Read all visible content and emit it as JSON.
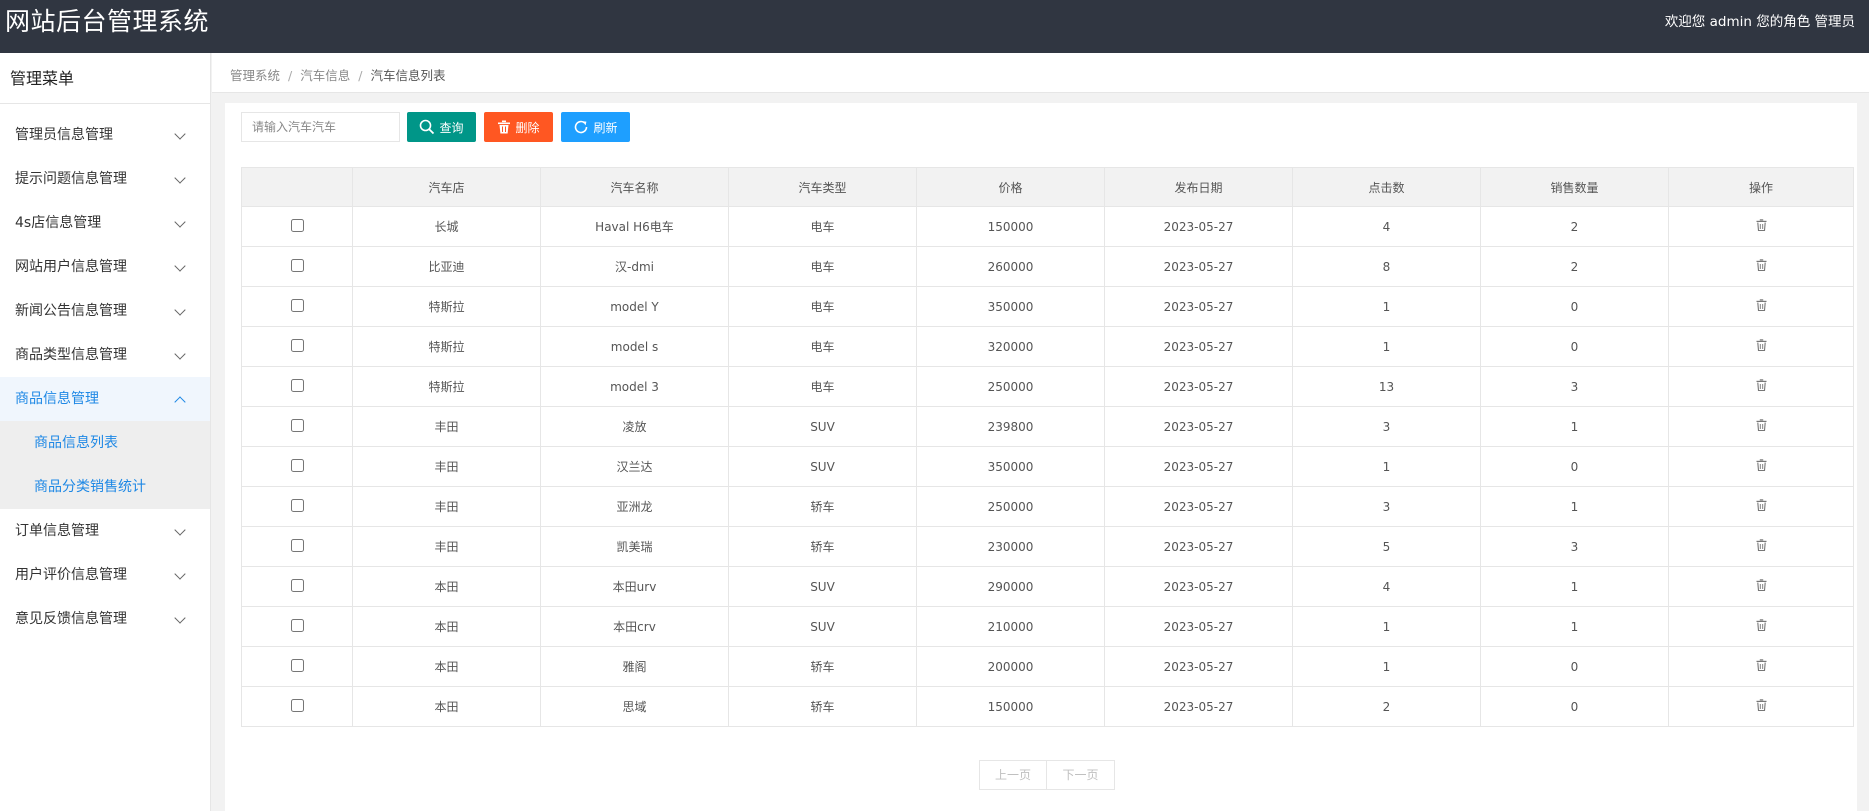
{
  "header": {
    "title": "网站后台管理系统",
    "welcome": "欢迎您 admin 您的角色 管理员"
  },
  "sidebar": {
    "title": "管理菜单",
    "items": [
      {
        "label": "管理员信息管理"
      },
      {
        "label": "提示问题信息管理"
      },
      {
        "label": "4s店信息管理"
      },
      {
        "label": "网站用户信息管理"
      },
      {
        "label": "新闻公告信息管理"
      },
      {
        "label": "商品类型信息管理"
      },
      {
        "label": "商品信息管理",
        "open": true,
        "children": [
          {
            "label": "商品信息列表"
          },
          {
            "label": "商品分类销售统计"
          }
        ]
      },
      {
        "label": "订单信息管理"
      },
      {
        "label": "用户评价信息管理"
      },
      {
        "label": "意见反馈信息管理"
      }
    ]
  },
  "breadcrumb": [
    "管理系统",
    "汽车信息",
    "汽车信息列表"
  ],
  "toolbar": {
    "search_placeholder": "请输入汽车汽车",
    "query_label": "查询",
    "delete_label": "删除",
    "refresh_label": "刷新"
  },
  "table": {
    "columns": [
      "",
      "汽车店",
      "汽车名称",
      "汽车类型",
      "价格",
      "发布日期",
      "点击数",
      "销售数量",
      "操作"
    ],
    "rows": [
      [
        "长城",
        "Haval H6电车",
        "电车",
        "150000",
        "2023-05-27",
        "4",
        "2"
      ],
      [
        "比亚迪",
        "汉-dmi",
        "电车",
        "260000",
        "2023-05-27",
        "8",
        "2"
      ],
      [
        "特斯拉",
        "model Y",
        "电车",
        "350000",
        "2023-05-27",
        "1",
        "0"
      ],
      [
        "特斯拉",
        "model s",
        "电车",
        "320000",
        "2023-05-27",
        "1",
        "0"
      ],
      [
        "特斯拉",
        "model 3",
        "电车",
        "250000",
        "2023-05-27",
        "13",
        "3"
      ],
      [
        "丰田",
        "凌放",
        "SUV",
        "239800",
        "2023-05-27",
        "3",
        "1"
      ],
      [
        "丰田",
        "汉兰达",
        "SUV",
        "350000",
        "2023-05-27",
        "1",
        "0"
      ],
      [
        "丰田",
        "亚洲龙",
        "轿车",
        "250000",
        "2023-05-27",
        "3",
        "1"
      ],
      [
        "丰田",
        "凯美瑞",
        "轿车",
        "230000",
        "2023-05-27",
        "5",
        "3"
      ],
      [
        "本田",
        "本田urv",
        "SUV",
        "290000",
        "2023-05-27",
        "4",
        "1"
      ],
      [
        "本田",
        "本田crv",
        "SUV",
        "210000",
        "2023-05-27",
        "1",
        "1"
      ],
      [
        "本田",
        "雅阁",
        "轿车",
        "200000",
        "2023-05-27",
        "1",
        "0"
      ],
      [
        "本田",
        "思域",
        "轿车",
        "150000",
        "2023-05-27",
        "2",
        "0"
      ]
    ]
  },
  "pager": {
    "prev_label": "上一页",
    "next_label": "下一页"
  },
  "colors": {
    "header_bg": "#303641",
    "accent": "#1e88e5",
    "query_btn": "#009688",
    "delete_btn": "#ff5722",
    "refresh_btn": "#1e9fff"
  }
}
